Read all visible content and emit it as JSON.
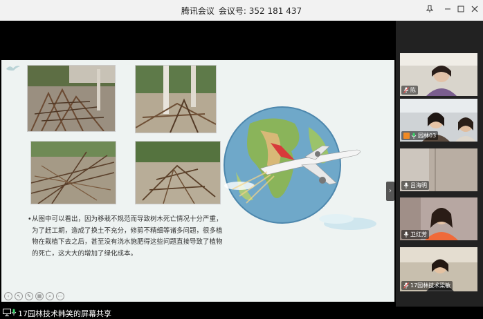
{
  "window": {
    "app_title": "腾讯会议",
    "meeting_label": "会议号:",
    "meeting_id": "352 181 437",
    "controls": [
      "pin-icon",
      "minimize-icon",
      "maximize-icon",
      "close-icon"
    ]
  },
  "slide": {
    "bullet_text": "从图中可以看出，因为移栽不规范而导致树木死亡情况十分严重，为了赶工期，造成了换土不充分，修剪不精细等诸多问题，很多植物在栽植下去之后，甚至没有浇水施肥得这些问题直接导致了植物的死亡，这大大的增加了绿化成本。"
  },
  "participants": [
    {
      "name": "陈",
      "mic": "muted",
      "has_video": true
    },
    {
      "name": "园林03",
      "mic": "speaking",
      "has_video": true
    },
    {
      "name": "吕海明",
      "mic": "on",
      "has_video": true
    },
    {
      "name": "卫红芳",
      "mic": "on",
      "has_video": true
    },
    {
      "name": "17园林技术梁敏",
      "mic": "muted",
      "has_video": true
    }
  ],
  "share_banner": {
    "label": "17园林技术韩笑的屏幕共享"
  },
  "colors": {
    "titlebar_bg": "#f2f2f2",
    "slide_bg": "#eef3f2",
    "panel_bg": "#222222",
    "accent_orange": "#f08a24"
  }
}
